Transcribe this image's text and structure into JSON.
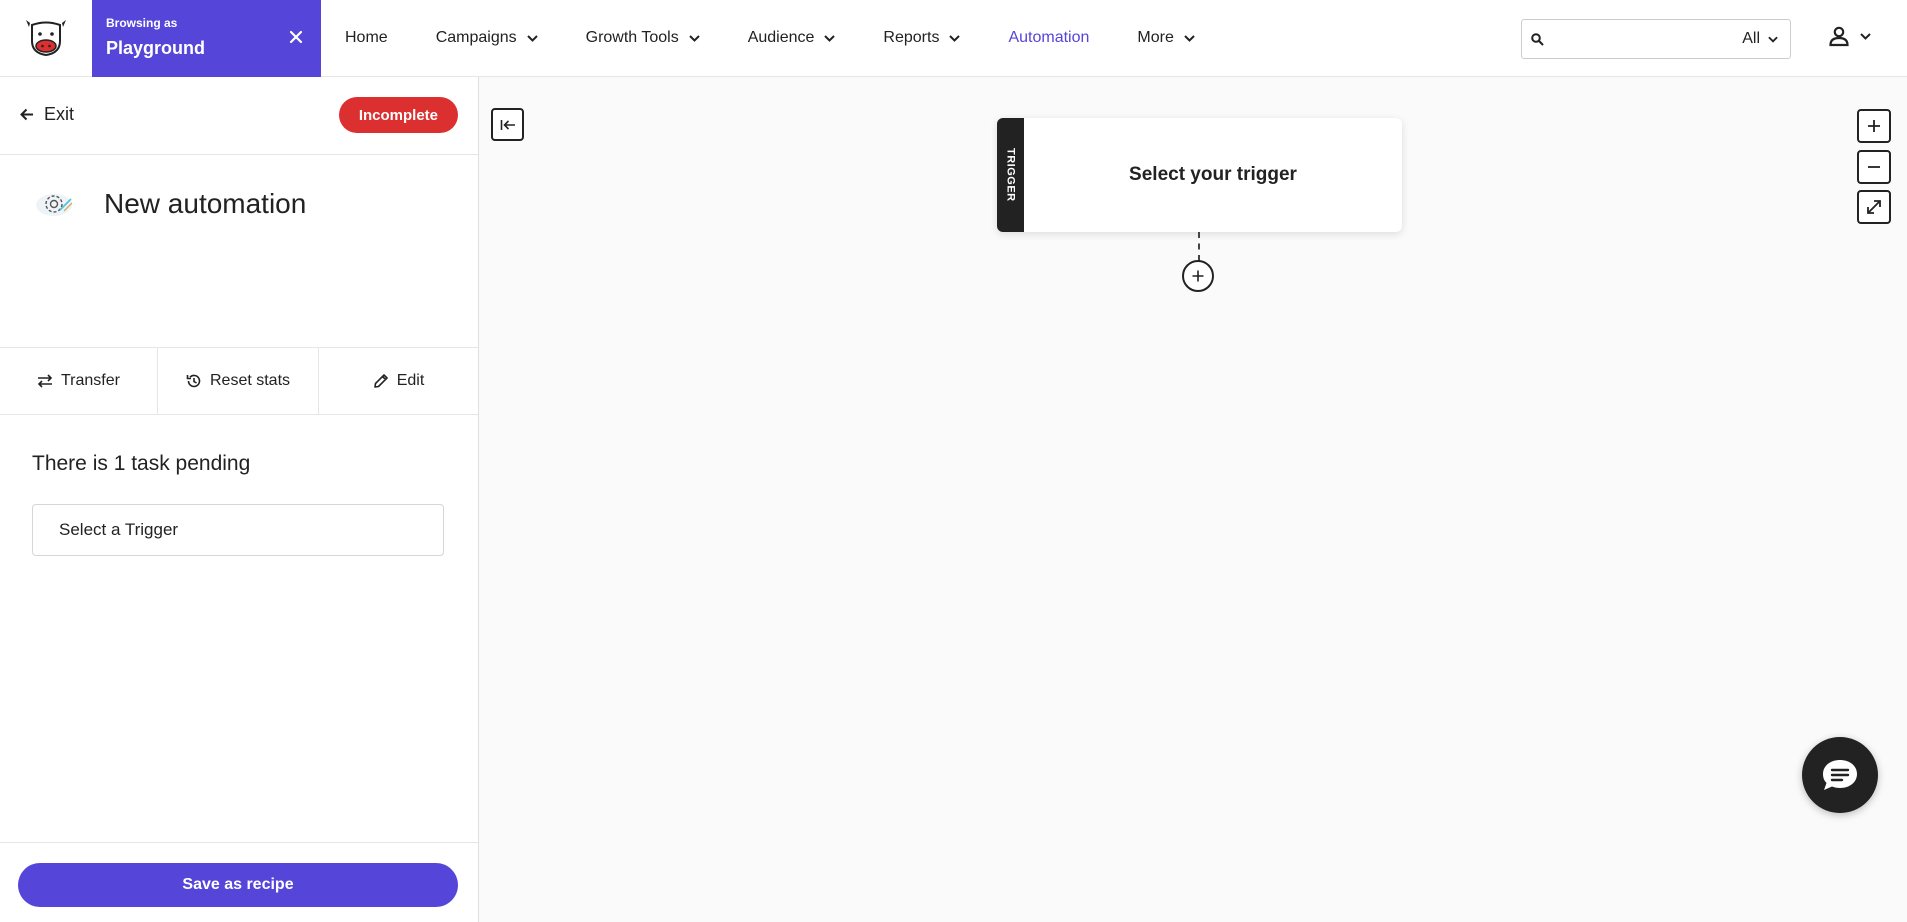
{
  "header": {
    "browsing_label": "Browsing as",
    "account_name": "Playground",
    "nav": [
      {
        "label": "Home"
      },
      {
        "label": "Campaigns"
      },
      {
        "label": "Growth Tools"
      },
      {
        "label": "Audience"
      },
      {
        "label": "Reports"
      },
      {
        "label": "Automation"
      },
      {
        "label": "More"
      }
    ],
    "search": {
      "value": "",
      "placeholder": "",
      "scope": "All"
    }
  },
  "sidebar": {
    "exit_label": "Exit",
    "status": "Incomplete",
    "automation_name": "New automation",
    "actions": {
      "transfer": "Transfer",
      "reset": "Reset stats",
      "edit": "Edit"
    },
    "tasks_title": "There is 1 task pending",
    "task": "Select a Trigger",
    "save_recipe": "Save as recipe"
  },
  "canvas": {
    "trigger_tab": "TRIGGER",
    "trigger_text": "Select your trigger"
  },
  "colors": {
    "accent": "#5545d9",
    "danger": "#dc2f2f",
    "dark": "#222222"
  },
  "icons": [
    "cow-logo-icon",
    "close-icon",
    "chevron-down-icon",
    "search-icon",
    "user-icon",
    "arrow-left-icon",
    "gear-icon",
    "transfer-icon",
    "history-icon",
    "pencil-icon",
    "collapse-panel-icon",
    "plus-icon",
    "minus-icon",
    "expand-icon",
    "chat-icon"
  ]
}
